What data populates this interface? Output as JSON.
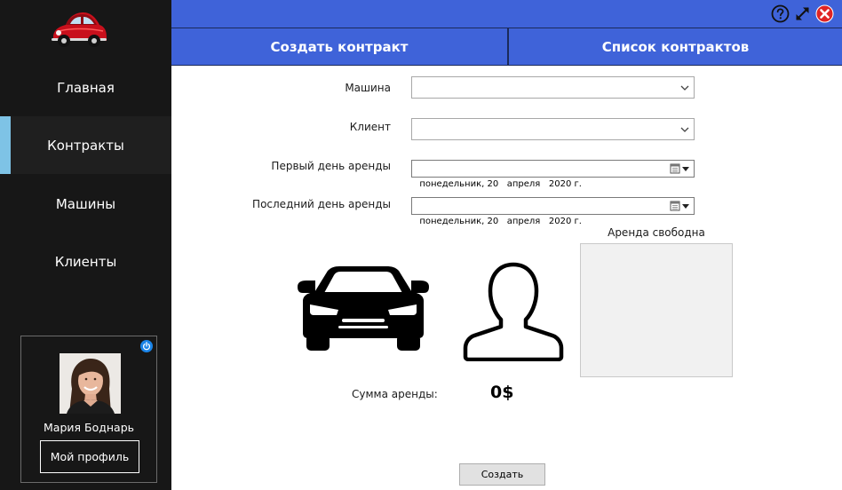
{
  "colors": {
    "sidebar_bg": "#171717",
    "accent_blue": "#3f63d9",
    "active_indicator": "#7ec3e6",
    "close_red": "#e02424",
    "power_blue": "#1a84e8"
  },
  "logo": {
    "icon": "red-beetle-car-logo"
  },
  "sidebar": {
    "items": [
      {
        "label": "Главная",
        "active": false
      },
      {
        "label": "Контракты",
        "active": true
      },
      {
        "label": "Машины",
        "active": false
      },
      {
        "label": "Клиенты",
        "active": false
      }
    ]
  },
  "profile": {
    "name": "Мария Боднарь",
    "button_label": "Мой профиль",
    "power_icon": "power-icon"
  },
  "window_controls": {
    "help_icon": "help-circle-icon",
    "maximize_icon": "expand-arrows-icon",
    "close_icon": "close-circle-icon"
  },
  "tabs": [
    {
      "label": "Создать контракт",
      "active": true
    },
    {
      "label": "Список контрактов",
      "active": false
    }
  ],
  "form": {
    "car_label": "Машина",
    "car_value": "",
    "client_label": "Клиент",
    "client_value": "",
    "start_label": "Первый день аренды",
    "start_value": "понедельник, 20   апреля   2020 г.",
    "end_label": "Последний день аренды",
    "end_value": "понедельник, 20   апреля   2020 г.",
    "status_label": "Аренда свободна",
    "sum_label": "Сумма аренды:",
    "sum_value": "0$",
    "submit_label": "Создать"
  }
}
